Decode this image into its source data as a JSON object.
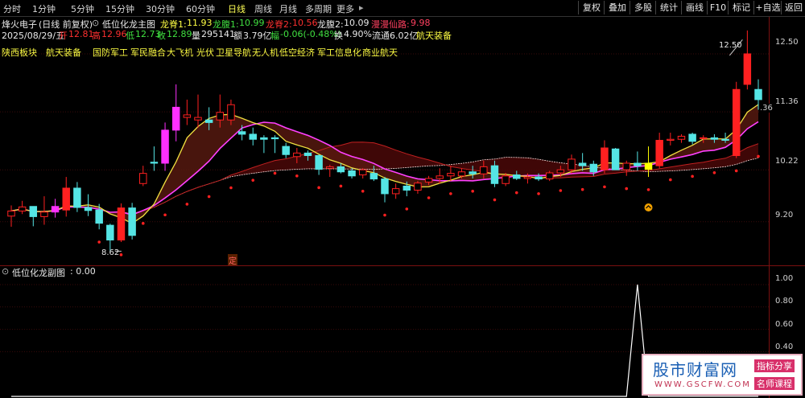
{
  "toolbar": {
    "periods": [
      "分时",
      "1分钟",
      "5分钟",
      "15分钟",
      "30分钟",
      "60分钟",
      "日线",
      "周线",
      "月线",
      "多周期",
      "更多"
    ],
    "active_period": "日线",
    "buttons": [
      "复权",
      "叠加",
      "多股",
      "统计",
      "画线",
      "F10",
      "标记",
      "+自选",
      "返回"
    ]
  },
  "header": {
    "stock_name": "烽火电子",
    "mode": "(日线 前复权)",
    "indicator_name": "低位化龙主图",
    "longji_label": "龙脊1:",
    "longji_value": "11.93",
    "longfu1_label": "龙腹1:",
    "longfu1_value": "10.99",
    "longji2_label": "龙脊2:",
    "longji2_value": "10.56",
    "longfu2_label": "龙腹2:",
    "longfu2_value": "10.09",
    "mantou_label": "漫漫仙路:",
    "mantou_value": "9.98"
  },
  "quote": {
    "date": "2025/08/29/五",
    "open_label": "开",
    "open": "12.81",
    "high_label": "高",
    "high": "12.96",
    "low_label": "低",
    "low": "12.73",
    "close_label": "收",
    "close": "12.89",
    "volume_label": "量",
    "volume": "295141",
    "amount_label": "额",
    "amount": "3.79亿",
    "change_label": "幅",
    "change": "-0.06(-0.48%)",
    "turnover_label": "换",
    "turnover": "4.90%",
    "float_label": "流通",
    "float": "6.02亿",
    "sector": "航天装备"
  },
  "concepts": [
    "陕西板块",
    "航天装备",
    "国防军工",
    "军民融合",
    "大飞机",
    "光伏",
    "卫星导航",
    "无人机",
    "低空经济",
    "军工信息化",
    "商业航天"
  ],
  "price_axis": [
    "12.50",
    "11.36",
    "10.22",
    "9.20"
  ],
  "markers": {
    "high_label": "12.50",
    "low_label": "8.62",
    "cut_label": ".36",
    "ding_label": "定"
  },
  "sub_panel": {
    "title": "低位化龙副图",
    "value": ": 0.00",
    "axis": [
      "1.00",
      "0.80",
      "0.60",
      "0.40"
    ]
  },
  "watermark": {
    "brand": "股市财富网",
    "url": "WWW.GSCFW.COM",
    "tag1": "指标分享",
    "tag2": "名师课程"
  },
  "colors": {
    "up": "#ff2020",
    "down": "#55e5e5",
    "magenta": "#ff30ff",
    "yellow_text": "#ffff44",
    "green_text": "#40e040"
  },
  "chart_data": {
    "type": "candlestick",
    "series": [
      {
        "name": "K",
        "ohlc": [
          [
            9.31,
            9.52,
            9.1,
            9.41
          ],
          [
            9.41,
            9.61,
            9.35,
            9.49
          ],
          [
            9.5,
            9.5,
            9.11,
            9.3
          ],
          [
            9.3,
            9.7,
            9.14,
            9.39
          ],
          [
            9.39,
            9.65,
            9.28,
            9.5
          ],
          [
            9.43,
            10.08,
            9.3,
            9.86
          ],
          [
            9.86,
            9.98,
            9.39,
            9.48
          ],
          [
            9.48,
            9.74,
            9.31,
            9.42
          ],
          [
            9.43,
            9.55,
            9.05,
            9.17
          ],
          [
            9.13,
            9.16,
            8.62,
            8.84
          ],
          [
            8.84,
            9.56,
            8.8,
            9.47
          ],
          [
            9.47,
            9.57,
            8.85,
            8.93
          ],
          [
            9.95,
            10.3,
            9.9,
            10.15
          ],
          [
            10.37,
            10.68,
            10.2,
            10.35
          ],
          [
            10.35,
            11.15,
            10.2,
            11.0
          ],
          [
            11.0,
            11.9,
            10.78,
            11.45
          ],
          [
            11.25,
            11.6,
            11.1,
            11.3
          ],
          [
            11.2,
            11.7,
            11.05,
            11.25
          ],
          [
            11.2,
            11.45,
            11.0,
            11.15
          ],
          [
            11.2,
            11.7,
            11.05,
            11.35
          ],
          [
            11.2,
            11.6,
            11.1,
            11.5
          ],
          [
            10.97,
            11.1,
            10.8,
            10.92
          ],
          [
            10.92,
            11.05,
            10.7,
            10.82
          ],
          [
            10.85,
            10.9,
            10.55,
            10.82
          ],
          [
            10.85,
            10.9,
            10.55,
            10.83
          ],
          [
            10.68,
            10.75,
            10.45,
            10.52
          ],
          [
            10.48,
            10.65,
            10.35,
            10.55
          ],
          [
            10.55,
            10.6,
            10.4,
            10.5
          ],
          [
            10.5,
            10.52,
            10.12,
            10.23
          ],
          [
            10.25,
            10.32,
            10.08,
            10.28
          ],
          [
            10.28,
            10.35,
            10.15,
            10.18
          ],
          [
            10.2,
            10.25,
            10.05,
            10.1
          ],
          [
            10.12,
            10.25,
            10.05,
            10.22
          ],
          [
            10.15,
            10.3,
            10.0,
            10.04
          ],
          [
            10.04,
            10.08,
            9.58,
            9.75
          ],
          [
            9.75,
            9.95,
            9.65,
            9.85
          ],
          [
            9.9,
            9.99,
            9.7,
            9.82
          ],
          [
            9.82,
            10.0,
            9.75,
            9.96
          ],
          [
            9.98,
            10.1,
            9.92,
            10.05
          ],
          [
            10.05,
            10.25,
            9.95,
            10.1
          ],
          [
            10.1,
            10.3,
            10.0,
            10.15
          ],
          [
            10.1,
            10.25,
            10.05,
            10.18
          ],
          [
            10.18,
            10.3,
            10.05,
            10.14
          ],
          [
            10.14,
            10.4,
            10.05,
            10.28
          ],
          [
            10.3,
            10.4,
            9.88,
            9.95
          ],
          [
            9.95,
            10.16,
            9.9,
            10.1
          ],
          [
            10.12,
            10.2,
            10.02,
            10.05
          ],
          [
            10.05,
            10.15,
            9.95,
            10.08
          ],
          [
            10.08,
            10.15,
            10.0,
            10.04
          ],
          [
            10.04,
            10.2,
            10.0,
            10.16
          ],
          [
            10.16,
            10.3,
            10.08,
            10.22
          ],
          [
            10.22,
            10.52,
            10.15,
            10.43
          ],
          [
            10.35,
            10.55,
            10.2,
            10.3
          ],
          [
            10.33,
            10.4,
            10.1,
            10.18
          ],
          [
            10.22,
            10.8,
            10.15,
            10.65
          ],
          [
            10.63,
            10.65,
            10.22,
            10.22
          ],
          [
            10.22,
            10.4,
            10.1,
            10.35
          ],
          [
            10.35,
            10.58,
            10.2,
            10.3
          ],
          [
            10.35,
            10.68,
            10.08,
            10.23
          ],
          [
            10.3,
            10.95,
            10.25,
            10.8
          ],
          [
            10.8,
            10.95,
            10.7,
            10.82
          ],
          [
            10.82,
            10.92,
            10.75,
            10.88
          ],
          [
            10.92,
            10.95,
            10.72,
            10.78
          ],
          [
            10.85,
            10.9,
            10.75,
            10.85
          ],
          [
            10.85,
            10.92,
            10.75,
            10.82
          ],
          [
            10.82,
            10.95,
            10.75,
            10.8
          ],
          [
            10.5,
            11.95,
            10.45,
            11.8
          ],
          [
            11.9,
            12.96,
            11.8,
            12.5
          ],
          [
            11.8,
            12.0,
            11.4,
            11.6
          ]
        ]
      }
    ],
    "ylim": [
      8.5,
      12.8
    ],
    "sub_series": {
      "name": "低位化龙副图",
      "values_peak_index": 57,
      "peak": 1.0,
      "ylim": [
        0,
        1.05
      ]
    }
  }
}
